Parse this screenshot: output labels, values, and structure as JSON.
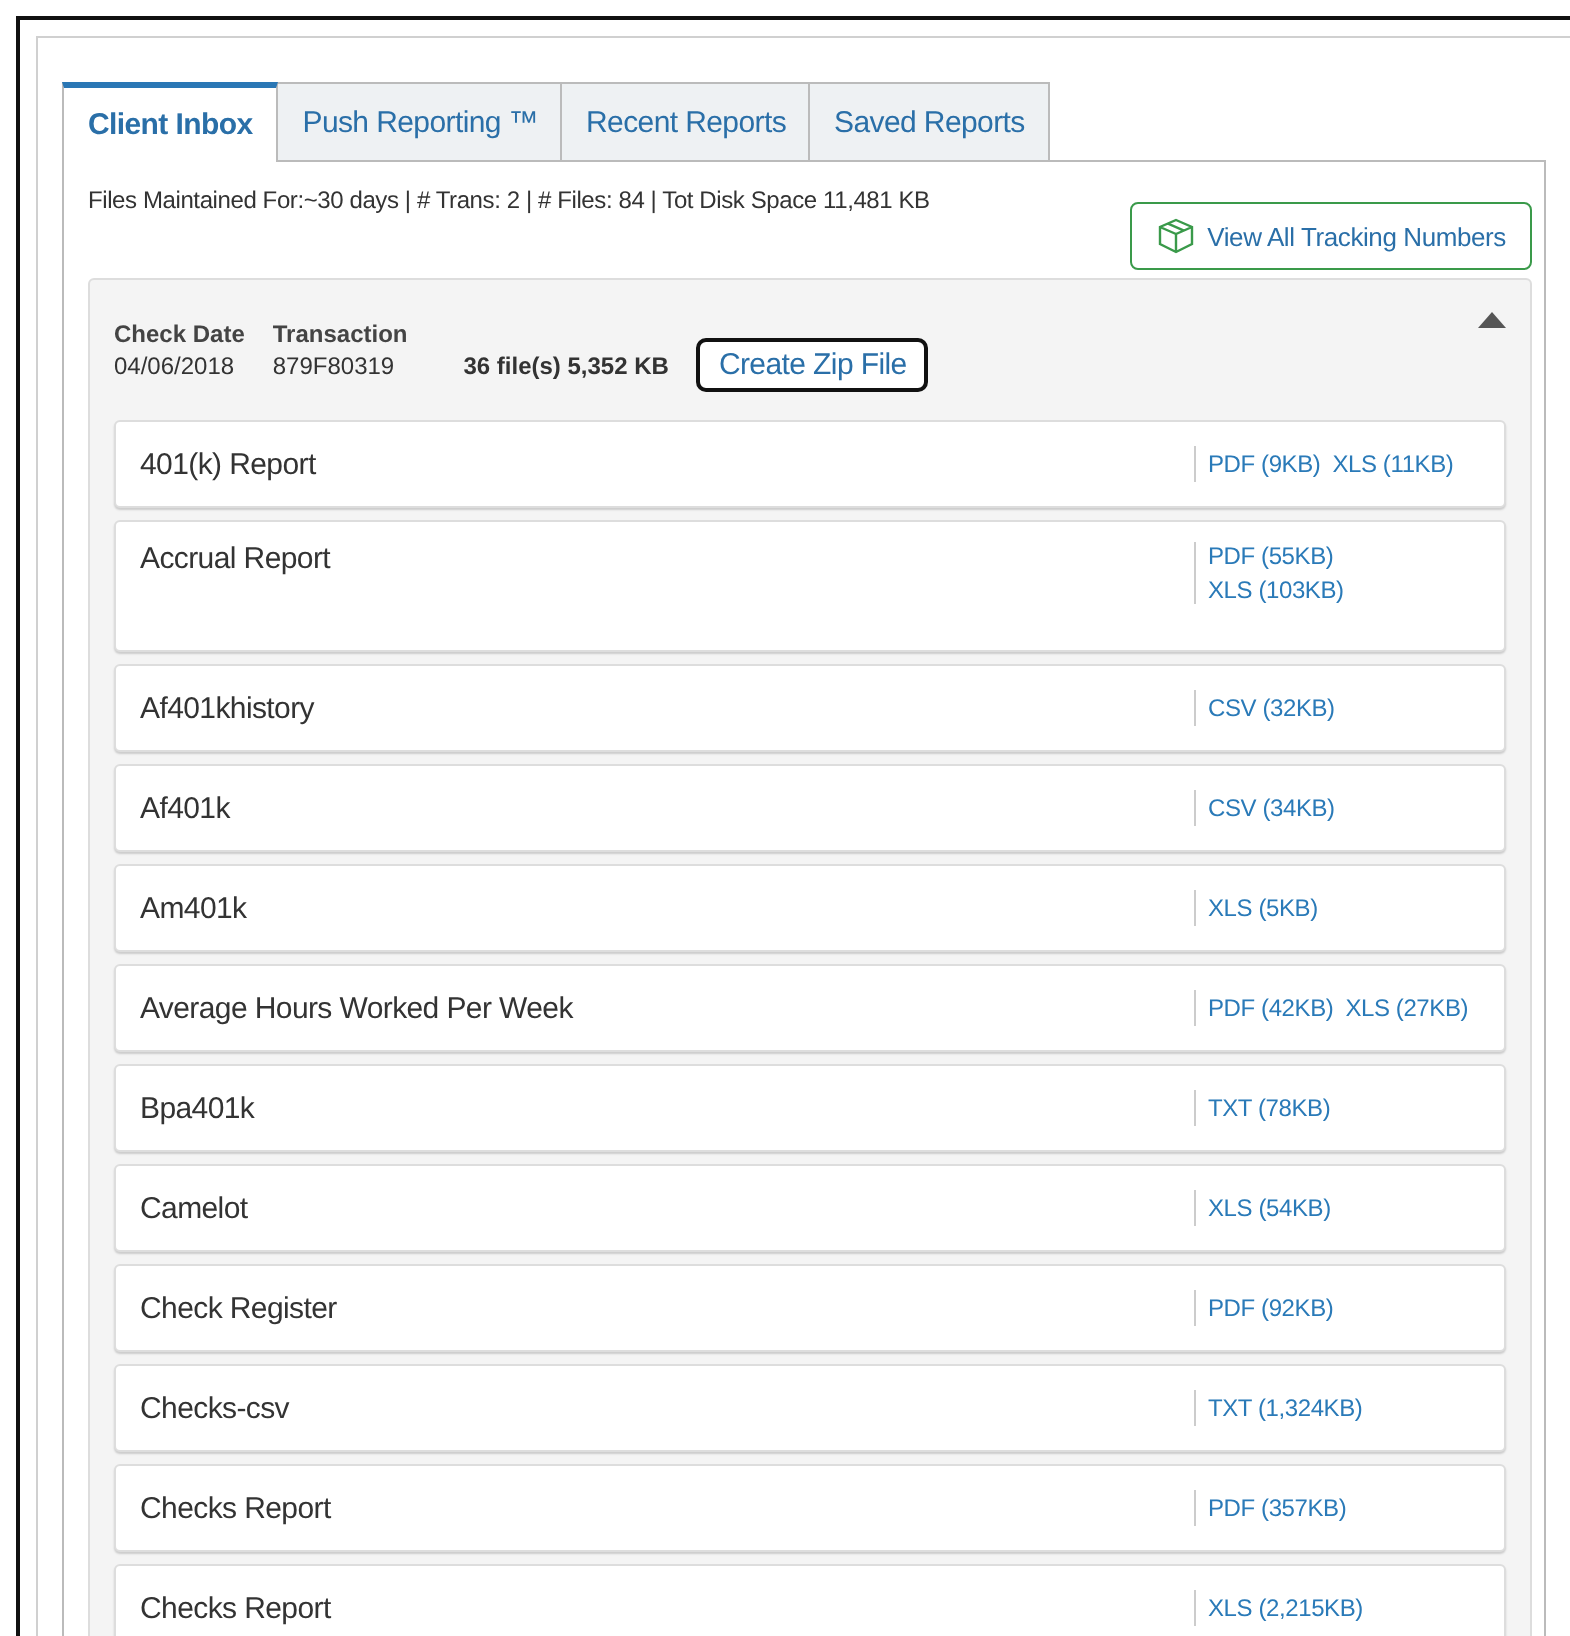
{
  "tabs": [
    {
      "label": "Client Inbox",
      "selected": true
    },
    {
      "label": "Push Reporting ™",
      "selected": false
    },
    {
      "label": "Recent Reports",
      "selected": false
    },
    {
      "label": "Saved Reports",
      "selected": false
    }
  ],
  "summary": "Files Maintained For:~30 days  | # Trans: 2 | # Files: 84 | Tot Disk Space 11,481 KB",
  "tracking_button": "View All Tracking Numbers",
  "transaction": {
    "check_date_label": "Check Date",
    "check_date": "04/06/2018",
    "transaction_label": "Transaction",
    "transaction_id": "879F80319",
    "files_info": "36 file(s) 5,352 KB",
    "zip_button": "Create Zip File",
    "expanded": true
  },
  "reports": [
    {
      "name": "401(k) Report",
      "files": [
        "PDF (9KB)",
        "XLS (11KB)"
      ]
    },
    {
      "name": "Accrual Report",
      "files": [
        "PDF (55KB)",
        "XLS (103KB)"
      ]
    },
    {
      "name": "Af401khistory",
      "files": [
        "CSV (32KB)"
      ]
    },
    {
      "name": "Af401k",
      "files": [
        "CSV (34KB)"
      ]
    },
    {
      "name": "Am401k",
      "files": [
        "XLS (5KB)"
      ]
    },
    {
      "name": "Average Hours Worked Per Week",
      "files": [
        "PDF (42KB)",
        "XLS (27KB)"
      ]
    },
    {
      "name": "Bpa401k",
      "files": [
        "TXT (78KB)"
      ]
    },
    {
      "name": "Camelot",
      "files": [
        "XLS (54KB)"
      ]
    },
    {
      "name": "Check Register",
      "files": [
        "PDF (92KB)"
      ]
    },
    {
      "name": "Checks-csv",
      "files": [
        "TXT (1,324KB)"
      ]
    },
    {
      "name": "Checks Report",
      "files": [
        "PDF (357KB)"
      ]
    },
    {
      "name": "Checks Report",
      "files": [
        "XLS (2,215KB)"
      ]
    }
  ]
}
